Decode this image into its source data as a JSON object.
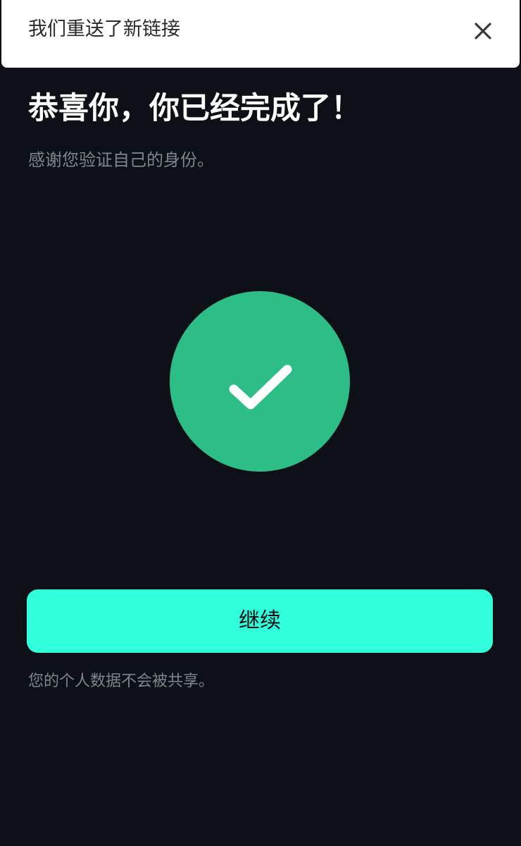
{
  "toast": {
    "message": "我们重送了新链接",
    "close_icon": "close-icon"
  },
  "main": {
    "headline": "恭喜你，你已经完成了！",
    "subtext": "感谢您验证自己的身份。",
    "status_icon": "checkmark-icon",
    "continue_label": "继续",
    "privacy_note": "您的个人数据不会被共享。"
  },
  "colors": {
    "background": "#0d1016",
    "success": "#2dbd87",
    "accent": "#31ffdb",
    "muted_text": "#7f848d"
  }
}
